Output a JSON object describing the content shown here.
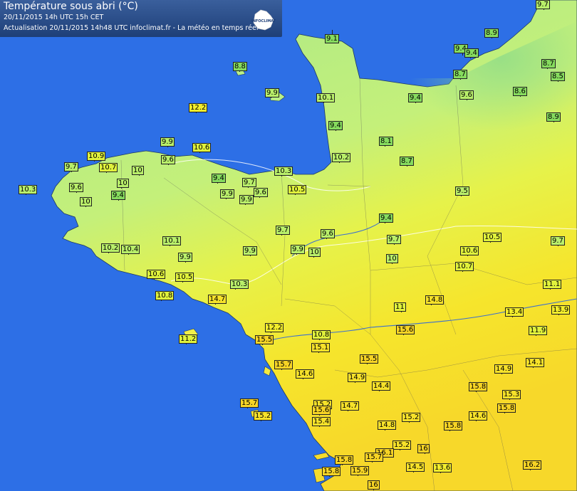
{
  "header": {
    "title": "Température sous abri (°C)",
    "line1": "20/11/2015  14h UTC  15h CET",
    "line2": "Actualisation 20/11/2015 14h48 UTC   infoclimat.fr - La météo en temps réel",
    "logo_text": "INFOCLIMAT"
  },
  "colors": {
    "sea": "#2d6fe6",
    "cold": "#b6ef7a",
    "mild": "#e8f04a",
    "warm": "#f7e52a",
    "hot": "#f5d62a"
  },
  "stations": [
    {
      "value": "9.7"
    },
    {
      "value": "9.1"
    },
    {
      "value": "8.9"
    },
    {
      "value": "9.4"
    },
    {
      "value": "9.4"
    },
    {
      "value": "8.8"
    },
    {
      "value": "8.7"
    },
    {
      "value": "8.5"
    },
    {
      "value": "8.7"
    },
    {
      "value": "9.9"
    },
    {
      "value": "10.1"
    },
    {
      "value": "9.4"
    },
    {
      "value": "9.6"
    },
    {
      "value": "8.6"
    },
    {
      "value": "12.2"
    },
    {
      "value": "8.9"
    },
    {
      "value": "9.4"
    },
    {
      "value": "9.9"
    },
    {
      "value": "10.6"
    },
    {
      "value": "8.1"
    },
    {
      "value": "10.9"
    },
    {
      "value": "9.6"
    },
    {
      "value": "10.2"
    },
    {
      "value": "8.7"
    },
    {
      "value": "9.7"
    },
    {
      "value": "10.7"
    },
    {
      "value": "10"
    },
    {
      "value": "9.4"
    },
    {
      "value": "10.3"
    },
    {
      "value": "9.6"
    },
    {
      "value": "10"
    },
    {
      "value": "9.7"
    },
    {
      "value": "10.5"
    },
    {
      "value": "9.5"
    },
    {
      "value": "10.3"
    },
    {
      "value": "9.4"
    },
    {
      "value": "9.6"
    },
    {
      "value": "9.9"
    },
    {
      "value": "9.9"
    },
    {
      "value": "10"
    },
    {
      "value": "9.4"
    },
    {
      "value": "10.1"
    },
    {
      "value": "9.7"
    },
    {
      "value": "9.6"
    },
    {
      "value": "10.5"
    },
    {
      "value": "9.7"
    },
    {
      "value": "10.2"
    },
    {
      "value": "10.4"
    },
    {
      "value": "9.9"
    },
    {
      "value": "9.9"
    },
    {
      "value": "10"
    },
    {
      "value": "10.6"
    },
    {
      "value": "9.7"
    },
    {
      "value": "9.9"
    },
    {
      "value": "10.6"
    },
    {
      "value": "10.5"
    },
    {
      "value": "10.7"
    },
    {
      "value": "10.8"
    },
    {
      "value": "10"
    },
    {
      "value": "10.3"
    },
    {
      "value": "14.7"
    },
    {
      "value": "11.1"
    },
    {
      "value": "11"
    },
    {
      "value": "14.8"
    },
    {
      "value": "13.4"
    },
    {
      "value": "13.9"
    },
    {
      "value": "12.2"
    },
    {
      "value": "11.2"
    },
    {
      "value": "10.8"
    },
    {
      "value": "15.6"
    },
    {
      "value": "11.9"
    },
    {
      "value": "15.5"
    },
    {
      "value": "15.1"
    },
    {
      "value": "15.7"
    },
    {
      "value": "15.5"
    },
    {
      "value": "14.6"
    },
    {
      "value": "14.9"
    },
    {
      "value": "14.9"
    },
    {
      "value": "14.1"
    },
    {
      "value": "14.4"
    },
    {
      "value": "15.8"
    },
    {
      "value": "15.7"
    },
    {
      "value": "15.2"
    },
    {
      "value": "14.7"
    },
    {
      "value": "15.3"
    },
    {
      "value": "15.6"
    },
    {
      "value": "15.2"
    },
    {
      "value": "15.2"
    },
    {
      "value": "15.8"
    },
    {
      "value": "15.4"
    },
    {
      "value": "14.8"
    },
    {
      "value": "14.6"
    },
    {
      "value": "15.8"
    },
    {
      "value": "15.2"
    },
    {
      "value": "16"
    },
    {
      "value": "16.1"
    },
    {
      "value": "15.8"
    },
    {
      "value": "15.7"
    },
    {
      "value": "14.5"
    },
    {
      "value": "13.6"
    },
    {
      "value": "16.2"
    },
    {
      "value": "15.8"
    },
    {
      "value": "15.9"
    },
    {
      "value": "16"
    }
  ]
}
